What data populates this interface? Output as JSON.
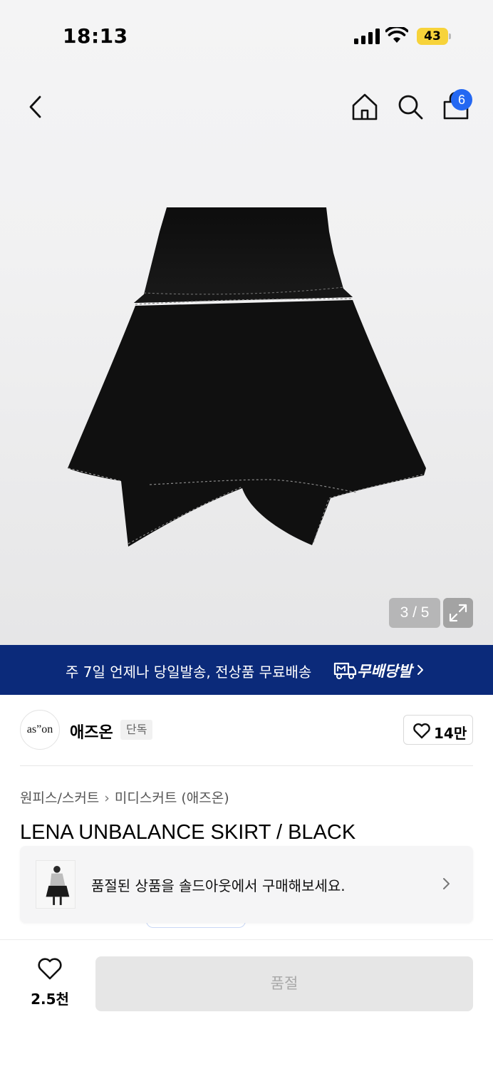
{
  "status_bar": {
    "time": "18:13",
    "battery": "43"
  },
  "header": {
    "cart_count": "6"
  },
  "gallery": {
    "counter": "3 / 5"
  },
  "promo": {
    "text": "주 7일 언제나 당일발송, 전상품 무료배송",
    "brand": "무배당발",
    "background": "#0b2a7a"
  },
  "brand": {
    "logo_text": "as”on",
    "name": "애즈온",
    "tag": "단독",
    "likes": "14만"
  },
  "breadcrumb": {
    "category": "원피스/스커트",
    "subcategory": "미디스커트 (애즈온)"
  },
  "product": {
    "title": "LENA UNBALANCE SKIRT / BLACK"
  },
  "soldout_banner": {
    "text": "품절된 상품을 솔드아웃에서 구매해보세요."
  },
  "bottom_bar": {
    "wish_count": "2.5천",
    "buy_label": "품절"
  },
  "colors": {
    "accent": "#2468f2",
    "battery": "#f7d33a"
  }
}
